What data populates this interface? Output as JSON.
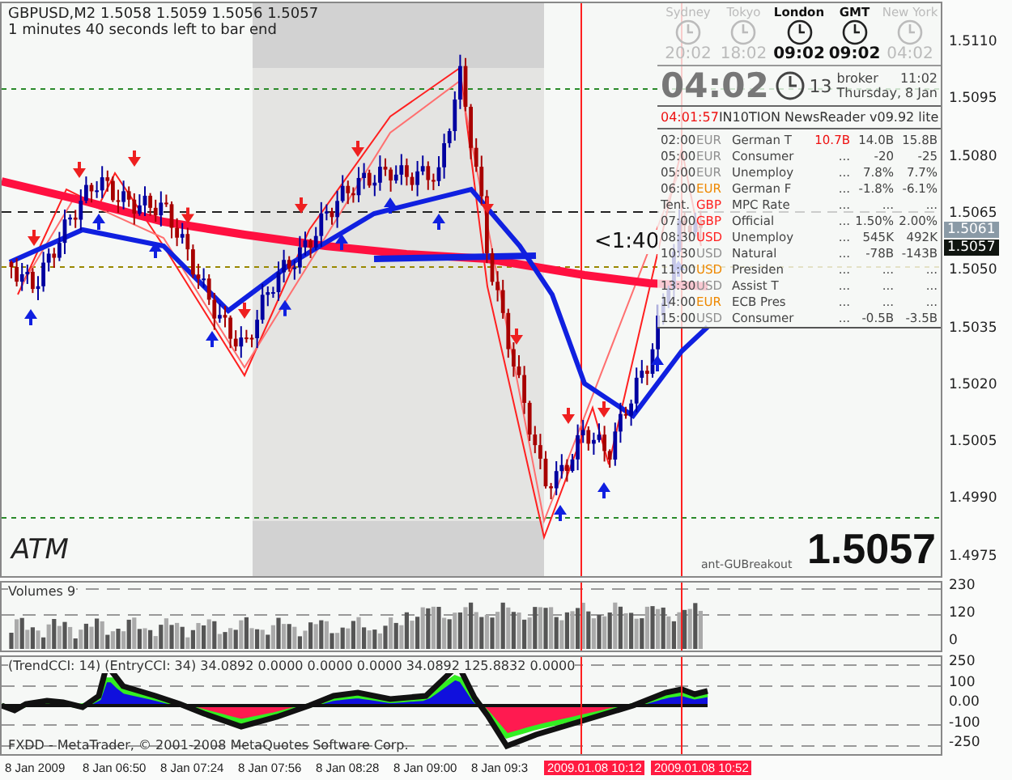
{
  "header": {
    "symbol_line": "GBPUSD,M2  1.5058 1.5059 1.5056 1.5057",
    "timer": "1 minutes 40 seconds left to bar end"
  },
  "price_axis": [
    "1.5110",
    "1.5095",
    "1.5080",
    "1.5065",
    "1.5050",
    "1.5035",
    "1.5020",
    "1.5005",
    "1.4990",
    "1.4975"
  ],
  "price_tags": [
    {
      "text": "1.5061",
      "kind": "bid"
    },
    {
      "text": "1.5057",
      "kind": "last"
    }
  ],
  "countdown": "<1:40",
  "atm_label": "ATM",
  "big_price": "1.5057",
  "ea_label": "ant-GUBreakout",
  "news": {
    "clocks": [
      {
        "city": "Sydney",
        "time": "20:02",
        "active": false
      },
      {
        "city": "Tokyo",
        "time": "18:02",
        "active": false
      },
      {
        "city": "London",
        "time": "09:02",
        "active": true
      },
      {
        "city": "GMT",
        "time": "09:02",
        "active": true
      },
      {
        "city": "New York",
        "time": "04:02",
        "active": false
      }
    ],
    "local_time": "04:02",
    "seconds": "13",
    "broker_label": "broker",
    "broker_time": "11:02",
    "date": "Thursday, 8 Jan",
    "clock_time": "04:01:57",
    "title": "IN10TION NewsReader v09.92 lite",
    "rows": [
      {
        "time": "02:00",
        "currency": "EUR",
        "color": "#909090",
        "event": "German T",
        "actual": "10.7B",
        "forecast": "14.0B",
        "previous": "15.8B"
      },
      {
        "time": "05:00",
        "currency": "EUR",
        "color": "#909090",
        "event": "Consumer",
        "actual": "...",
        "forecast": "-20",
        "previous": "-25"
      },
      {
        "time": "05:00",
        "currency": "EUR",
        "color": "#909090",
        "event": "Unemploy",
        "actual": "...",
        "forecast": "7.8%",
        "previous": "7.7%"
      },
      {
        "time": "06:00",
        "currency": "EUR",
        "color": "#ee8800",
        "event": "German F",
        "actual": "...",
        "forecast": "-1.8%",
        "previous": "-6.1%"
      },
      {
        "time": "Tent.",
        "currency": "GBP",
        "color": "#ff2020",
        "event": "MPC Rate",
        "actual": "...",
        "forecast": "...",
        "previous": "..."
      },
      {
        "time": "07:00",
        "currency": "GBP",
        "color": "#ff2020",
        "event": "Official",
        "actual": "...",
        "forecast": "1.50%",
        "previous": "2.00%"
      },
      {
        "time": "08:30",
        "currency": "USD",
        "color": "#ff2020",
        "event": "Unemploy",
        "actual": "...",
        "forecast": "545K",
        "previous": "492K"
      },
      {
        "time": "10:30",
        "currency": "USD",
        "color": "#909090",
        "event": "Natural",
        "actual": "...",
        "forecast": "-78B",
        "previous": "-143B"
      },
      {
        "time": "11:00",
        "currency": "USD",
        "color": "#ee8800",
        "event": "Presiden",
        "actual": "...",
        "forecast": "...",
        "previous": "..."
      },
      {
        "time": "13:30",
        "currency": "USD",
        "color": "#909090",
        "event": "Assist T",
        "actual": "...",
        "forecast": "...",
        "previous": "..."
      },
      {
        "time": "14:00",
        "currency": "EUR",
        "color": "#ee8800",
        "event": "ECB Pres",
        "actual": "...",
        "forecast": "...",
        "previous": "..."
      },
      {
        "time": "15:00",
        "currency": "USD",
        "color": "#909090",
        "event": "Consumer",
        "actual": "...",
        "forecast": "-0.5B",
        "previous": "-3.5B"
      }
    ]
  },
  "volume": {
    "label": "Volumes 9",
    "axis": [
      "230",
      "120",
      "0"
    ]
  },
  "cci": {
    "label": "(TrendCCI: 14) (EntryCCI: 34) 34.0892 0.0000 0.0000 0.0000 34.0892 125.8832 0.0000",
    "axis": [
      "250",
      "100",
      "0.00",
      "-100",
      "-250"
    ],
    "copyright": "FXDD - MetaTrader, © 2001-2008 MetaQuotes Software Corp."
  },
  "time_axis": [
    {
      "text": "8 Jan 2009",
      "kind": "tick"
    },
    {
      "text": "8 Jan 06:50",
      "kind": "tick"
    },
    {
      "text": "8 Jan 07:24",
      "kind": "tick"
    },
    {
      "text": "8 Jan 07:56",
      "kind": "tick"
    },
    {
      "text": "8 Jan 08:28",
      "kind": "tick"
    },
    {
      "text": "8 Jan 09:00",
      "kind": "tick"
    },
    {
      "text": "8 Jan 09:3",
      "kind": "tick"
    },
    {
      "text": "2009.01.08 10:12",
      "kind": "marker"
    },
    {
      "text": "2009.01.08 10:52",
      "kind": "marker"
    }
  ]
}
